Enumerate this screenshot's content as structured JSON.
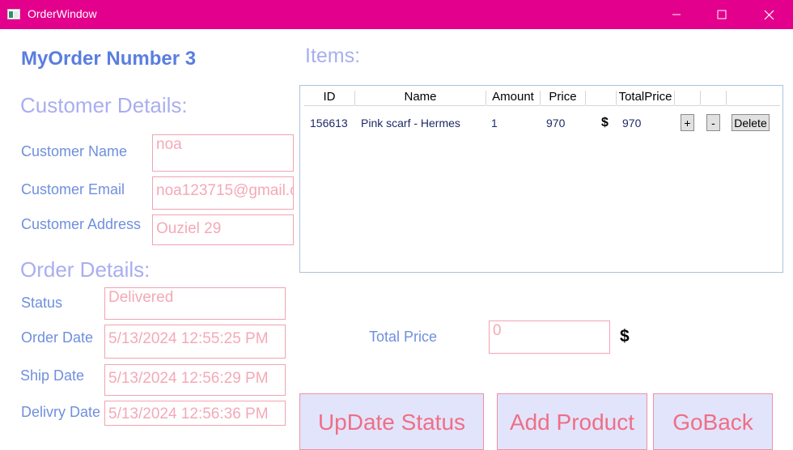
{
  "window": {
    "title": "OrderWindow",
    "accent": "#e3008c"
  },
  "order": {
    "heading": "MyOrder Number 3"
  },
  "customer": {
    "section": "Customer Details:",
    "name_label": "Customer Name",
    "name_value": "noa",
    "email_label": "Customer Email",
    "email_value": "noa123715@gmail.c",
    "address_label": "Customer Address",
    "address_value": "Ouziel 29"
  },
  "order_details": {
    "section": "Order Details:",
    "status_label": "Status",
    "status_value": "Delivered",
    "order_date_label": "Order Date",
    "order_date_value": "5/13/2024 12:55:25 PM",
    "ship_date_label": "Ship Date",
    "ship_date_value": "5/13/2024 12:56:29 PM",
    "delivery_date_label": "Delivry Date",
    "delivery_date_value": "5/13/2024 12:56:36 PM"
  },
  "items": {
    "heading": "Items:",
    "columns": [
      "ID",
      "Name",
      "Amount",
      "Price",
      "",
      "TotalPrice",
      "",
      "",
      ""
    ],
    "rows": [
      {
        "id": "156613",
        "name": "Pink scarf - Hermes",
        "amount": "1",
        "price": "970",
        "currency": "$",
        "total": "970",
        "plus": "+",
        "minus": "-",
        "delete": "Delete"
      }
    ]
  },
  "total": {
    "label": "Total Price",
    "value": "0",
    "currency": "$"
  },
  "buttons": {
    "update_status": "UpDate Status",
    "add_product": "Add Product",
    "go_back": "GoBack"
  }
}
